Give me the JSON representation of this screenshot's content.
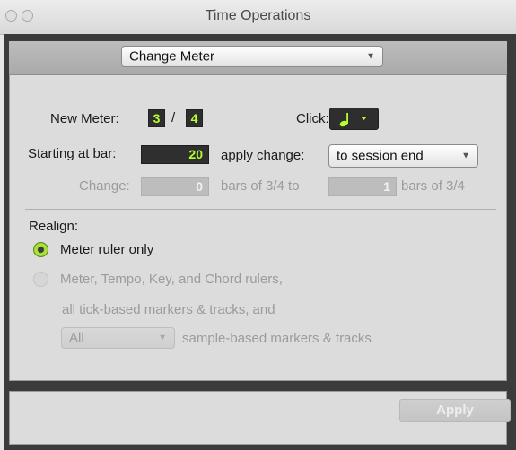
{
  "window": {
    "title": "Time Operations"
  },
  "operation": {
    "selected": "Change Meter"
  },
  "meter": {
    "new_meter_label": "New Meter:",
    "numerator": "3",
    "slash": "/",
    "denominator": "4",
    "click_label": "Click:",
    "click_icon": "quarter-note-icon"
  },
  "start": {
    "label": "Starting at bar:",
    "value": "20",
    "apply_change_label": "apply change:",
    "apply_change_selected": "to session end"
  },
  "change": {
    "label": "Change:",
    "value": "0",
    "bars_of_label": "bars of 3/4 to",
    "to_value": "1",
    "bars_of_label_2": "bars of 3/4"
  },
  "realign": {
    "label": "Realign:",
    "option1": "Meter ruler only",
    "option2_line1": "Meter, Tempo, Key, and Chord rulers,",
    "option2_line2": "all tick-based markers & tracks, and",
    "sample_selected": "All",
    "sample_label": "sample-based markers & tracks"
  },
  "footer": {
    "apply_label": "Apply"
  },
  "colors": {
    "lcd_green": "#b7ff2e",
    "radio_green": "#a8e23a"
  }
}
